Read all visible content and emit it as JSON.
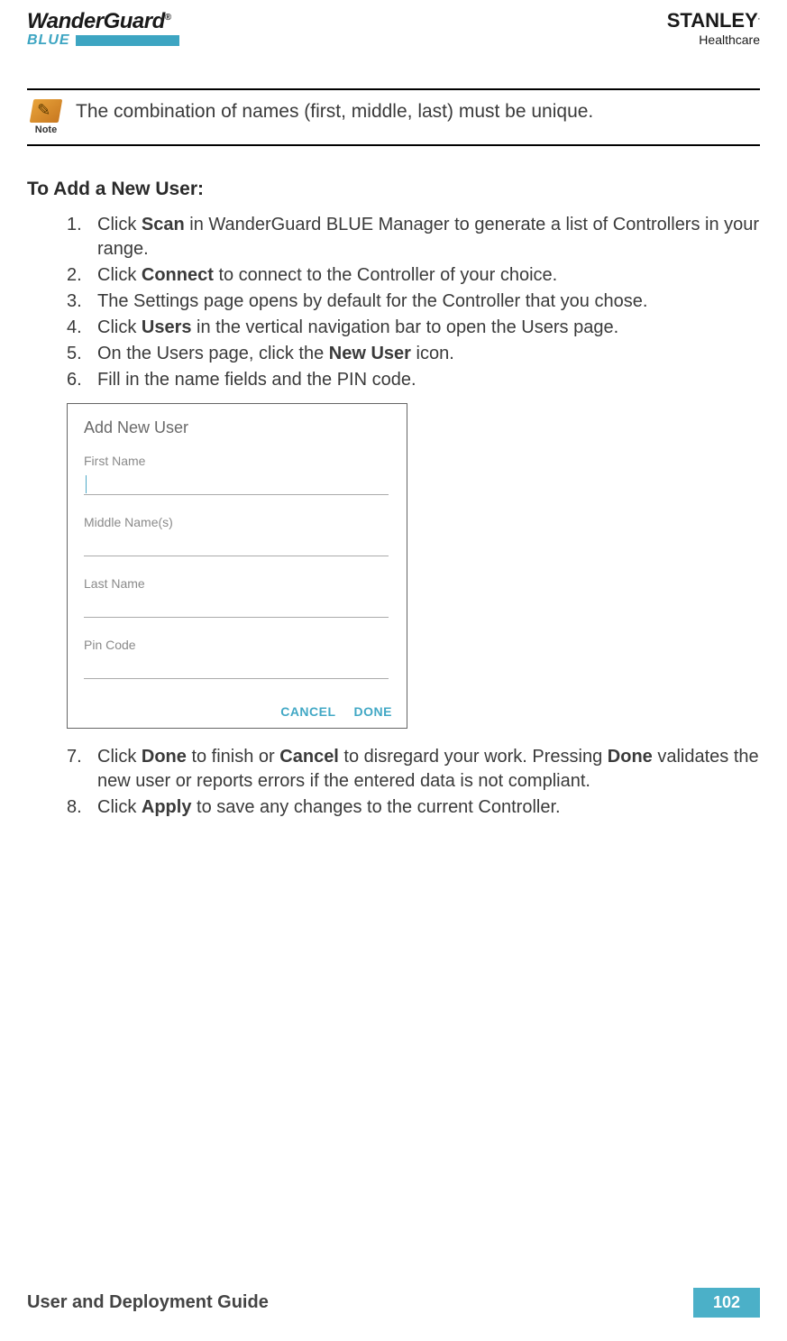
{
  "header": {
    "logo_top": "WanderGuard",
    "logo_reg": "®",
    "logo_blue": "BLUE",
    "stanley": "STANLEY",
    "healthcare": "Healthcare"
  },
  "note": {
    "label": "Note",
    "text": "The combination of names (first, middle, last) must be unique."
  },
  "section_title": "To Add a New User:",
  "steps": [
    {
      "num": "1.",
      "pre": "Click ",
      "b1": "Scan",
      "post1": " in WanderGuard BLUE Manager to generate a list of Controllers in your range."
    },
    {
      "num": "2.",
      "pre": "Click ",
      "b1": "Connect",
      "post1": " to connect to the Controller of your choice."
    },
    {
      "num": "3.",
      "pre": "The Settings page opens by default for the Controller that you chose."
    },
    {
      "num": "4.",
      "pre": "Click ",
      "b1": "Users",
      "post1": " in the vertical navigation bar to open the Users page."
    },
    {
      "num": "5.",
      "pre": "On the Users page, click the ",
      "b1": "New User",
      "post1": " icon."
    },
    {
      "num": "6.",
      "pre": "Fill in the name fields and the PIN code."
    }
  ],
  "dialog": {
    "title": "Add New User",
    "fields": {
      "first": "First Name",
      "middle": "Middle Name(s)",
      "last": "Last Name",
      "pin": "Pin Code"
    },
    "buttons": {
      "cancel": "CANCEL",
      "done": "DONE"
    }
  },
  "steps2": [
    {
      "num": "7.",
      "pre": "Click ",
      "b1": "Done",
      "mid1": " to finish or ",
      "b2": "Cancel",
      "mid2": " to disregard your work. Pressing ",
      "b3": "Done",
      "post": " validates the new user or reports errors if the entered data is not compliant."
    },
    {
      "num": "8.",
      "pre": "Click ",
      "b1": "Apply",
      "post1": " to save any changes to the current Controller."
    }
  ],
  "footer": {
    "title": "User and Deployment Guide",
    "page": "102"
  }
}
